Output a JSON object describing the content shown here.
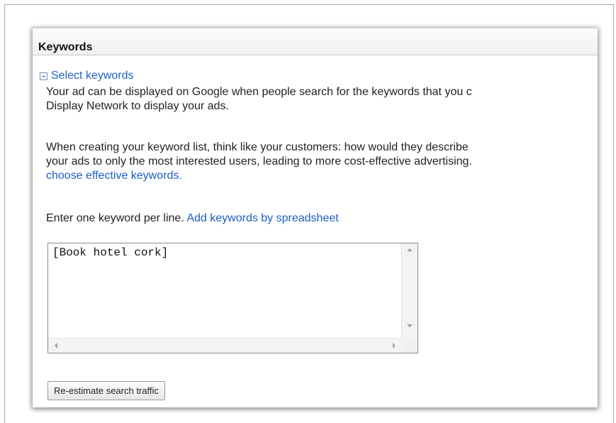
{
  "header": {
    "title": "Keywords"
  },
  "section": {
    "title": "Select keywords",
    "paragraph1_line1": "Your ad can be displayed on Google when people search for the keywords that you c",
    "paragraph1_line2": "Display Network to display your ads.",
    "paragraph2_line1": "When creating your keyword list, think like your customers: how would they describe",
    "paragraph2_line2": "your ads to only the most interested users, leading to more cost-effective advertising.",
    "paragraph2_link": "choose effective keywords.",
    "instruction_text": "Enter one keyword per line.",
    "spreadsheet_link": "Add keywords by spreadsheet"
  },
  "keywords_input": {
    "value": "[Book hotel cork]"
  },
  "buttons": {
    "reestimate": "Re-estimate search traffic"
  },
  "colors": {
    "link": "#1b5fc0",
    "header_bg": "#f1f1f1"
  }
}
